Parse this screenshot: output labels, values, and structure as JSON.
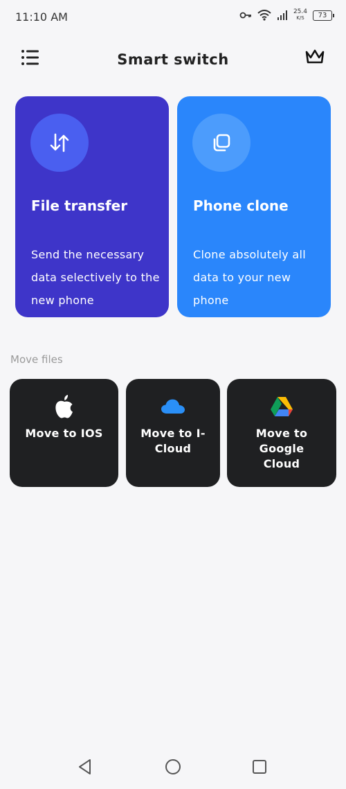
{
  "status_bar": {
    "time": "11:10 AM",
    "net_speed": "25.4",
    "net_speed_unit": "K/S",
    "battery": "73",
    "icons": [
      "vpn-key-icon",
      "wifi-icon",
      "signal-icon",
      "battery-icon"
    ]
  },
  "header": {
    "title": "Smart switch",
    "menu_icon": "menu-icon",
    "premium_icon": "crown-icon"
  },
  "cards": {
    "file_transfer": {
      "title": "File transfer",
      "description": "Send the necessary data selectively to the new phone",
      "icon": "transfer-arrows-icon",
      "color": "#3e35c9"
    },
    "phone_clone": {
      "title": "Phone clone",
      "description": "Clone absolutely all data to your new phone",
      "icon": "copy-icon",
      "color": "#2a86fb"
    }
  },
  "move_files": {
    "label": "Move files",
    "tiles": [
      {
        "label": "Move to IOS",
        "icon": "apple-icon"
      },
      {
        "label": "Move to I-Cloud",
        "icon": "cloud-icon"
      },
      {
        "label": "Move to Google Cloud",
        "icon": "google-drive-icon"
      }
    ]
  },
  "nav_bar": {
    "buttons": [
      "back-icon",
      "home-icon",
      "recents-icon"
    ]
  }
}
